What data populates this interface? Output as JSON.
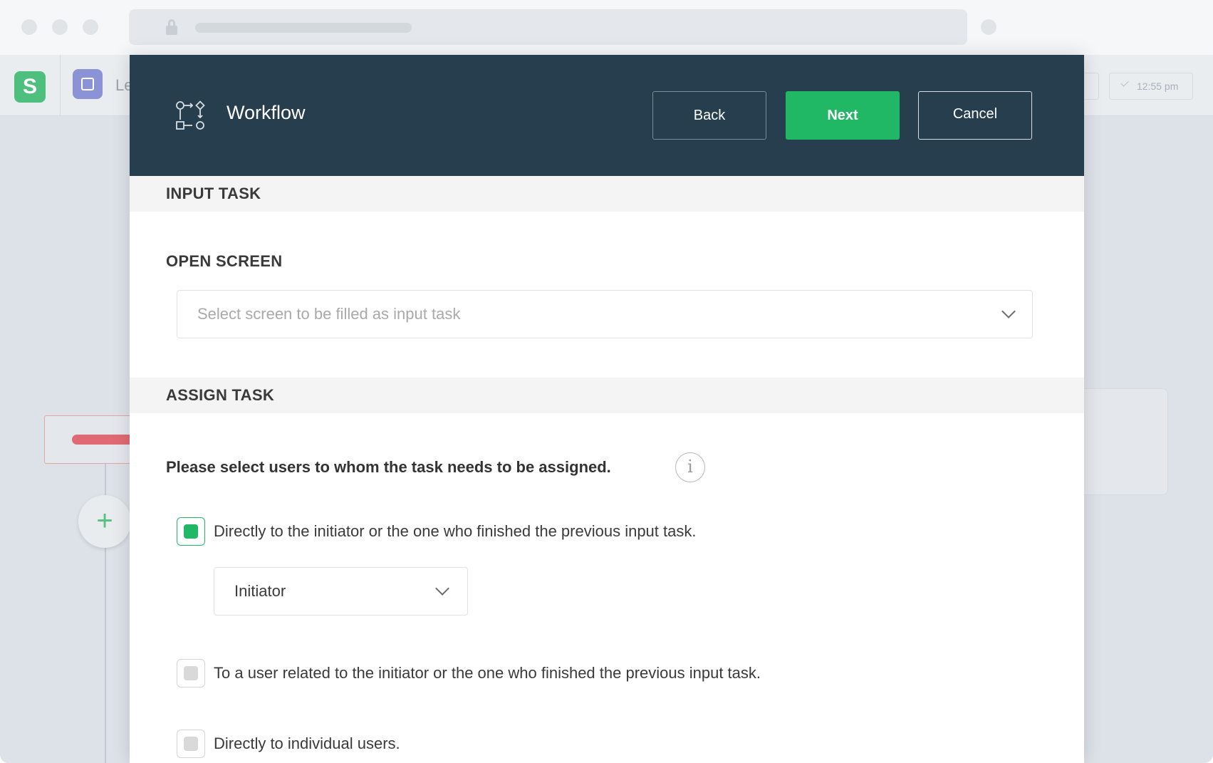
{
  "app": {
    "logo_glyph": "S",
    "module_label": "Le",
    "time": "12:55 pm"
  },
  "modal": {
    "title": "Workflow",
    "icon": "workflow-icon",
    "buttons": {
      "back": "Back",
      "next": "Next",
      "cancel": "Cancel"
    },
    "input_task": {
      "section_title": "INPUT TASK",
      "open_screen_label": "OPEN SCREEN",
      "screen_select_placeholder": "Select screen to be filled as input task"
    },
    "assign_task": {
      "section_title": "ASSIGN TASK",
      "question": "Please select users to whom the task needs to be assigned.",
      "info_glyph": "i",
      "options": [
        {
          "label": "Directly to the initiator or the one who finished the previous input task.",
          "checked": true
        },
        {
          "label": "To a user related to the initiator or the one who finished the previous input task.",
          "checked": false
        },
        {
          "label": "Directly to individual users.",
          "checked": false
        }
      ],
      "role_select_value": "Initiator"
    }
  },
  "colors": {
    "header_bg": "#263e4d",
    "accent_green": "#21b865",
    "section_bg": "#f4f4f4"
  }
}
